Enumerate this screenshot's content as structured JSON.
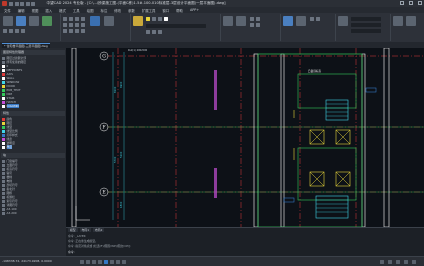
{
  "window": {
    "title": "中望CAD 2024 专业版 - [C:\\...\\桥梁施工图-(平面C栋)1-5#-100-010标准层-3层设计平面图(一层平面图).dwg]"
  },
  "menu": [
    "文件",
    "编辑",
    "视图",
    "插入",
    "格式",
    "工具",
    "绘图",
    "标注",
    "修改",
    "参数",
    "扩展工具",
    "窗口",
    "帮助",
    "APP+"
  ],
  "doc_tab": "* 住宅楼平面图-三层平面图.dwg",
  "palette": {
    "title": "图层特性管理器",
    "layers": [
      "图层过滤器全部",
      "所有使用的图层",
      "0",
      "DEFPOINTS",
      "AXIS",
      "WALL",
      "WINDOW",
      "DOOR",
      "PUB_TEXT",
      "DIM",
      "STAIR",
      "HATCH",
      "COLUMN"
    ],
    "props_title": "特性",
    "props": [
      "颜色",
      "图层",
      "线型",
      "线型比例",
      "打印样式",
      "线宽",
      "透明度",
      "厚度"
    ],
    "list_title": "块",
    "blocks": [
      "门窗编号",
      "立面符号",
      "标高符号",
      "轴号",
      "楼梯",
      "电梯",
      "剖切符号",
      "指北针",
      "图框",
      "标题栏",
      "索引符号",
      "详图符号",
      "A3-100",
      "A3-200"
    ]
  },
  "canvas": {
    "axis_labels": [
      "G",
      "F",
      "E"
    ],
    "dims": [
      "8100",
      "5700",
      "6900",
      "5100",
      "1800"
    ],
    "label_top": "凸窗顶标高",
    "label_tag": "KL2(1) 200x500"
  },
  "command": {
    "layout_tabs": [
      "模型",
      "布局1",
      "布局2"
    ],
    "lines": [
      "命令: _LAYER",
      "命令: 正在重生成模型。",
      "命令: 指定对角点或 [栏选(F)/圈围(WP)/圈交(CP)]:"
    ],
    "prompt": "命令:"
  },
  "status": {
    "coords": "-198338.72, 24173.9208, 0.0000"
  },
  "colors": {
    "accent": "#3577c4",
    "grid_red": "#e23b3b",
    "grid_green": "#32c85a",
    "cyan": "#3fd6e8",
    "yellow": "#e8d53a",
    "magenta": "#c44fd6"
  }
}
